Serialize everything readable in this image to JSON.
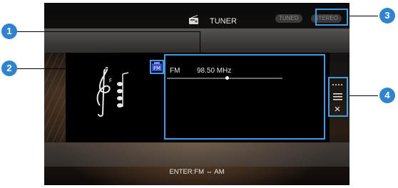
{
  "header": {
    "source_label": "TUNER",
    "badge_tuned": "TUNED",
    "badge_stereo": "STEREO"
  },
  "tuner": {
    "band": "FM",
    "frequency": "98.50 MHz",
    "tuning_position": 0.5
  },
  "footer": {
    "enter_hint": "ENTER:FM ⇔ AM"
  },
  "menu": {
    "items": [
      "ellipsis-icon",
      "list-icon",
      "close-icon"
    ]
  },
  "callouts": [
    "1",
    "2",
    "3",
    "4"
  ],
  "colors": {
    "callout": "#2f83cf",
    "highlight": "#3d9ee8"
  }
}
